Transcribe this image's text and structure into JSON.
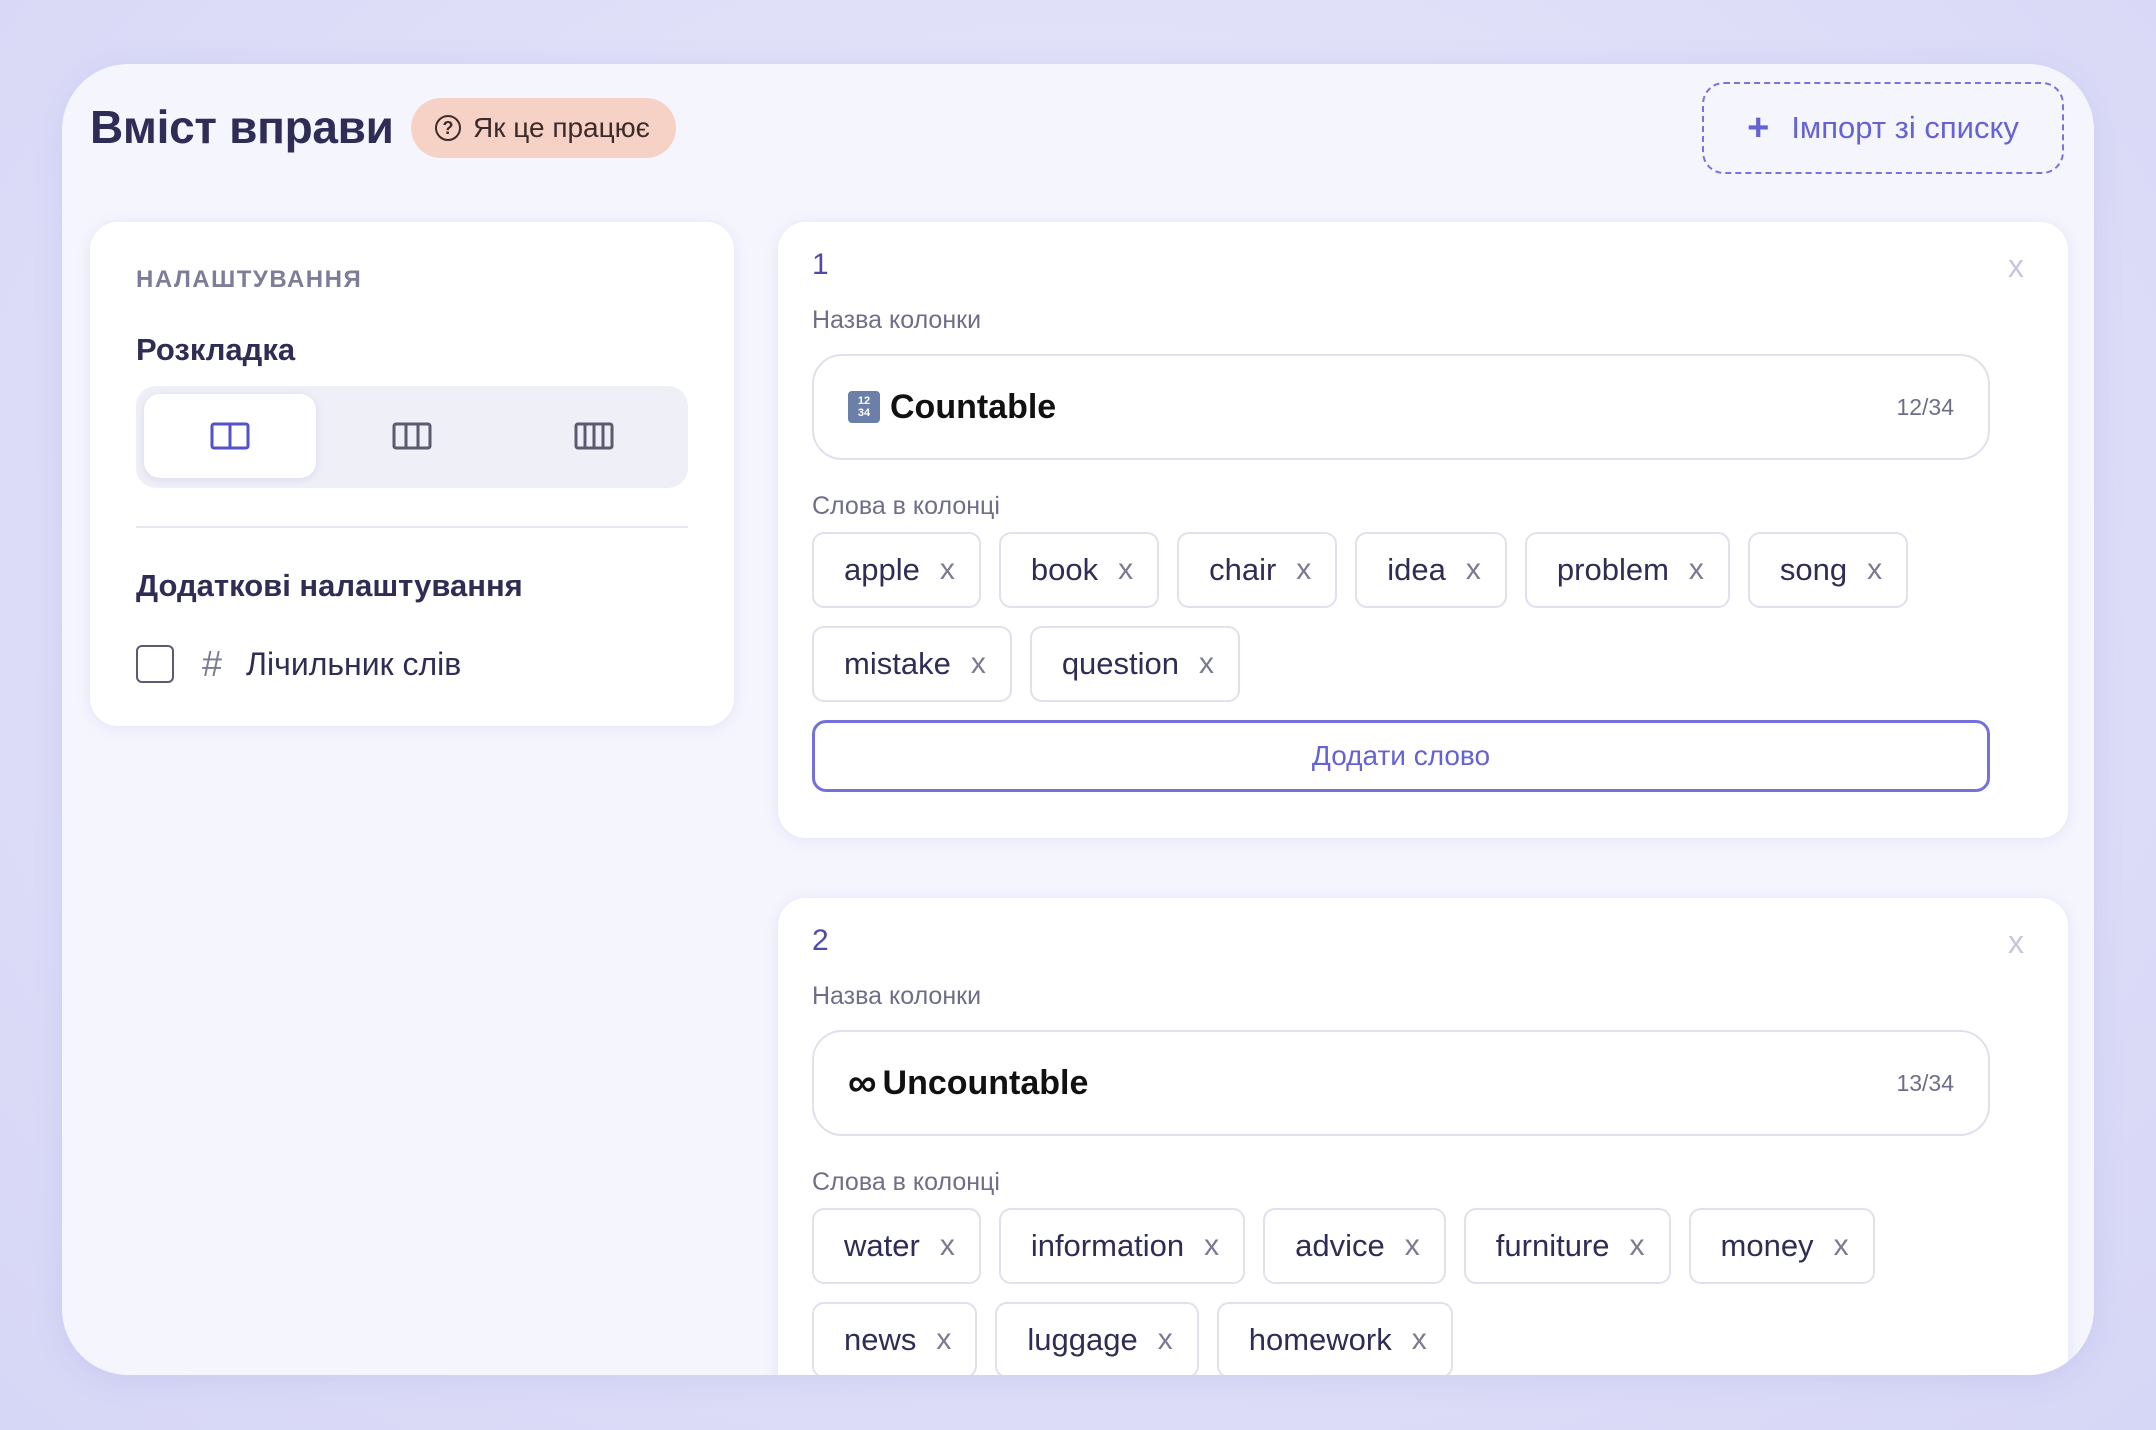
{
  "header": {
    "title": "Вміст вправи",
    "help_label": "Як це працює",
    "import_label": "Імпорт зі списку"
  },
  "settings": {
    "caption": "НАЛАШТУВАННЯ",
    "layout_title": "Розкладка",
    "layout_options": [
      "two-columns",
      "three-columns",
      "four-columns"
    ],
    "layout_selected": "two-columns",
    "extra_title": "Додаткові налаштування",
    "word_counter_label": "Лічильник слів",
    "word_counter_checked": false
  },
  "columns": [
    {
      "number": "1",
      "close_label": "x",
      "name_label": "Назва колонки",
      "name_value": "Countable",
      "name_icon": "input-numbers-emoji",
      "name_counter": "12/34",
      "words_label": "Слова в колонці",
      "words": [
        "apple",
        "book",
        "chair",
        "idea",
        "problem",
        "song",
        "mistake",
        "question"
      ],
      "remove_glyph": "x",
      "add_word_label": "Додати слово"
    },
    {
      "number": "2",
      "close_label": "x",
      "name_label": "Назва колонки",
      "name_value": "Uncountable",
      "name_icon": "infinity-emoji",
      "name_counter": "13/34",
      "words_label": "Слова в колонці",
      "words": [
        "water",
        "information",
        "advice",
        "furniture",
        "money",
        "news",
        "luggage",
        "homework"
      ],
      "remove_glyph": "x"
    }
  ],
  "colors": {
    "accent": "#6563d4",
    "help_pill_bg": "#f6d2c6",
    "panel_bg": "#f5f5fe"
  }
}
